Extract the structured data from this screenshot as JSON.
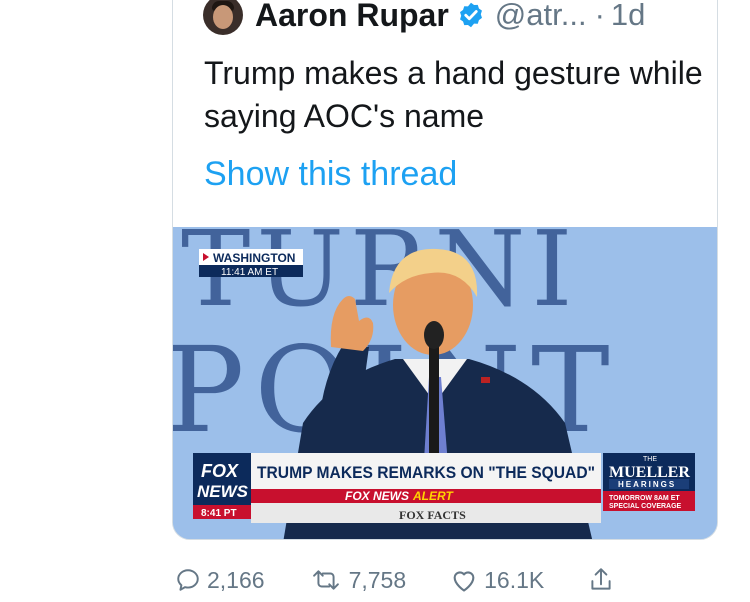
{
  "tweet": {
    "display_name": "Aaron Rupar",
    "handle": "@atr...",
    "separator": "·",
    "time": "1d",
    "text": "Trump makes a hand gesture while saying AOC's name",
    "show_thread": "Show this thread"
  },
  "media": {
    "location": "WASHINGTON",
    "location_time": "11:41 AM ET",
    "backdrop_text_top": "TURNI",
    "backdrop_text_bottom": "POINT",
    "network_logo_line1": "FOX",
    "network_logo_line2": "NEWS",
    "network_time": "8:41 PT",
    "headline": "TRUMP MAKES REMARKS ON \"THE SQUAD\"",
    "alert_brand": "FOX NEWS",
    "alert_label": "ALERT",
    "ticker": "FOX FACTS",
    "side_the": "THE",
    "side_title": "MUELLER",
    "side_subtitle": "HEARINGS",
    "side_line1": "TOMORROW 8AM ET",
    "side_line2": "SPECIAL COVERAGE",
    "colors": {
      "sky": "#8fb6e6",
      "banner_red": "#c8102e",
      "fox_navy": "#0c2a5b",
      "alert_yellow": "#ffd400"
    }
  },
  "stats": {
    "replies": "2,166",
    "retweets": "7,758",
    "likes": "16.1K"
  },
  "icons": {
    "verified": "verified-badge-icon",
    "reply": "reply-icon",
    "retweet": "retweet-icon",
    "like": "heart-icon",
    "share": "share-icon"
  },
  "accent_color": "#1da1f2"
}
